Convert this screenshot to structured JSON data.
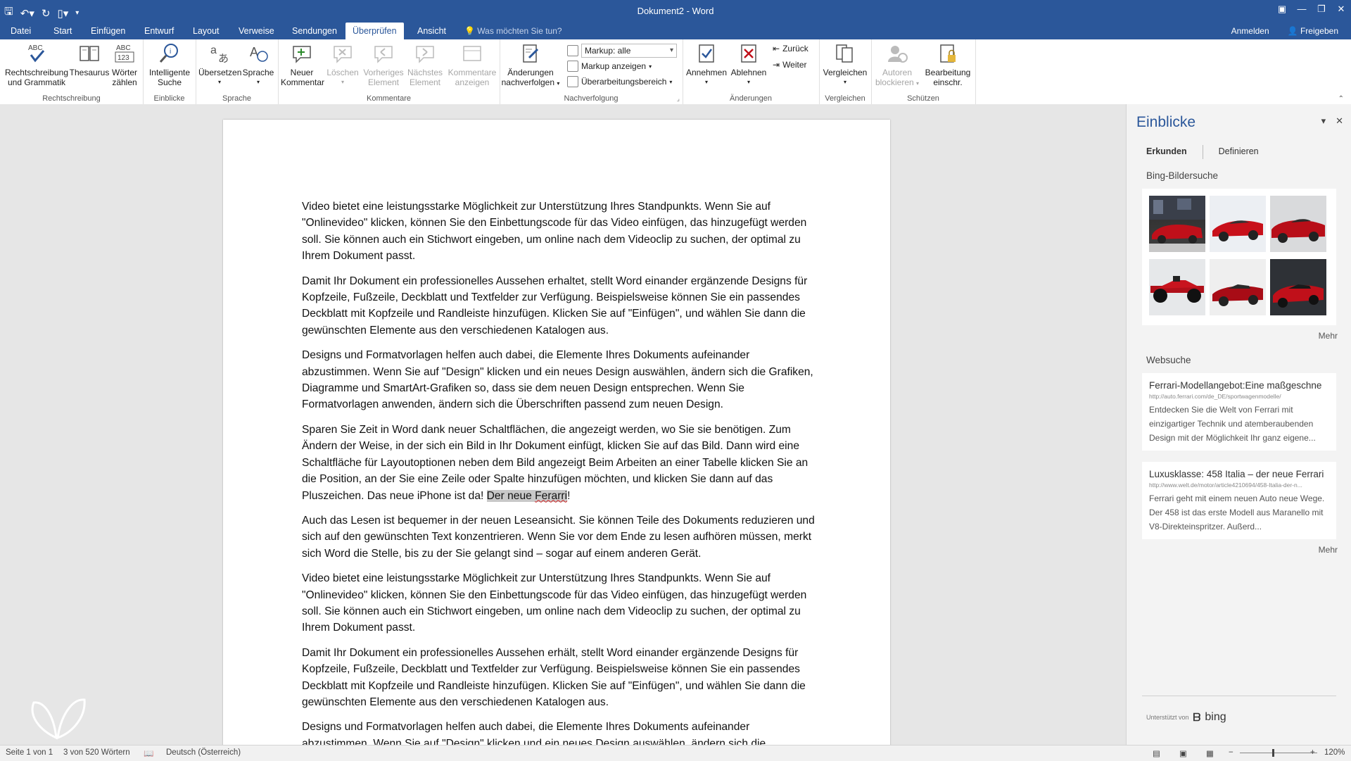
{
  "window": {
    "title": "Dokument2 - Word"
  },
  "tabs": [
    {
      "label": "Datei"
    },
    {
      "label": "Start"
    },
    {
      "label": "Einfügen"
    },
    {
      "label": "Entwurf"
    },
    {
      "label": "Layout"
    },
    {
      "label": "Verweise"
    },
    {
      "label": "Sendungen"
    },
    {
      "label": "Überprüfen"
    },
    {
      "label": "Ansicht"
    }
  ],
  "tell_me": "Was möchten Sie tun?",
  "account": {
    "signin": "Anmelden",
    "share": "Freigeben"
  },
  "ribbon": {
    "groups": {
      "rechtschreibung": "Rechtschreibung",
      "einblicke": "Einblicke",
      "sprache": "Sprache",
      "kommentare": "Kommentare",
      "nachverfolgung": "Nachverfolgung",
      "aenderungen": "Änderungen",
      "vergleichen": "Vergleichen",
      "schuetzen": "Schützen"
    },
    "buttons": {
      "spelling_1": "Rechtschreibung",
      "spelling_2": "und Grammatik",
      "thesaurus": "Thesaurus",
      "wordcount_1": "Wörter",
      "wordcount_2": "zählen",
      "smart_1": "Intelligente",
      "smart_2": "Suche",
      "translate": "Übersetzen",
      "language": "Sprache",
      "newcomment_1": "Neuer",
      "newcomment_2": "Kommentar",
      "delete": "Löschen",
      "prev_1": "Vorheriges",
      "prev_2": "Element",
      "next_1": "Nächstes",
      "next_2": "Element",
      "showcomments_1": "Kommentare",
      "showcomments_2": "anzeigen",
      "track_1": "Änderungen",
      "track_2": "nachverfolgen",
      "markup_combo": "Markup: alle",
      "show_markup": "Markup anzeigen",
      "review_pane": "Überarbeitungsbereich",
      "accept": "Annehmen",
      "reject": "Ablehnen",
      "back": "Zurück",
      "forward": "Weiter",
      "compare": "Vergleichen",
      "block_1": "Autoren",
      "block_2": "blockieren",
      "restrict_1": "Bearbeitung",
      "restrict_2": "einschr."
    }
  },
  "document": {
    "paragraphs": [
      "Video bietet eine leistungsstarke Möglichkeit zur Unterstützung Ihres Standpunkts. Wenn Sie auf \"Onlinevideo\" klicken, können Sie den Einbettungscode für das Video einfügen, das hinzugefügt werden soll. Sie können auch ein Stichwort eingeben, um online nach dem Videoclip zu suchen, der optimal zu Ihrem Dokument passt.",
      "Damit Ihr Dokument ein professionelles Aussehen erhaltet, stellt Word einander ergänzende Designs für Kopfzeile, Fußzeile, Deckblatt und Textfelder zur Verfügung. Beispielsweise können Sie ein passendes Deckblatt mit Kopfzeile und Randleiste hinzufügen. Klicken Sie auf \"Einfügen\", und wählen Sie dann die gewünschten Elemente aus den verschiedenen Katalogen aus.",
      "Designs und Formatvorlagen helfen auch dabei, die Elemente Ihres Dokuments aufeinander abzustimmen. Wenn Sie auf \"Design\" klicken und ein neues Design auswählen, ändern sich die Grafiken, Diagramme und SmartArt-Grafiken so, dass sie dem neuen Design entsprechen. Wenn Sie Formatvorlagen anwenden, ändern sich die Überschriften passend zum neuen Design.",
      "Sparen Sie Zeit in Word dank neuer Schaltflächen, die angezeigt werden, wo Sie sie benötigen. Zum Ändern der Weise, in der sich ein Bild in Ihr Dokument einfügt, klicken Sie auf das Bild. Dann wird eine Schaltfläche für Layoutoptionen neben dem Bild angezeigt Beim Arbeiten an einer Tabelle klicken Sie an die Position, an der Sie eine Zeile oder Spalte hinzufügen möchten, und klicken Sie dann auf das Pluszeichen. Das neue iPhone ist da!",
      "Auch das Lesen ist bequemer in der neuen Leseansicht. Sie können Teile des Dokuments reduzieren und sich auf den gewünschten Text konzentrieren. Wenn Sie vor dem Ende zu lesen aufhören müssen, merkt sich Word die Stelle, bis zu der Sie gelangt sind – sogar auf einem anderen Gerät.",
      "Video bietet eine leistungsstarke Möglichkeit zur Unterstützung Ihres Standpunkts. Wenn Sie auf \"Onlinevideo\" klicken, können Sie den Einbettungscode für das Video einfügen, das hinzugefügt werden soll. Sie können auch ein Stichwort eingeben, um online nach dem Videoclip zu suchen, der optimal zu Ihrem Dokument passt.",
      "Damit Ihr Dokument ein professionelles Aussehen erhält, stellt Word einander ergänzende Designs für Kopfzeile, Fußzeile, Deckblatt und Textfelder zur Verfügung. Beispielsweise können Sie ein passendes Deckblatt mit Kopfzeile und Randleiste hinzufügen. Klicken Sie auf \"Einfügen\", und wählen Sie dann die gewünschten Elemente aus den verschiedenen Katalogen aus.",
      "Designs und Formatvorlagen helfen auch dabei, die Elemente Ihres Dokuments aufeinander abzustimmen. Wenn Sie auf \"Design\" klicken und ein neues Design auswählen, ändern sich die"
    ],
    "selection_pre": "Der neue ",
    "selection_word": "Ferarri",
    "selection_post": "!"
  },
  "insights": {
    "title": "Einblicke",
    "tabs": {
      "explore": "Erkunden",
      "define": "Definieren"
    },
    "image_section": "Bing-Bildersuche",
    "more": "Mehr",
    "web_section": "Websuche",
    "results": [
      {
        "title": "Ferrari-Modellangebot:Eine maßgeschne",
        "url": "http://auto.ferrari.com/de_DE/sportwagenmodelle/",
        "desc": "Entdecken Sie die Welt von Ferrari mit einzigartiger Technik und atemberaubenden Design mit der Möglichkeit Ihr ganz eigene..."
      },
      {
        "title": "Luxusklasse: 458 Italia – der neue Ferrari",
        "url": "http://www.welt.de/motor/article4210694/458-Italia-der-n...",
        "desc": "Ferrari geht mit einem neuen Auto neue Wege. Der 458 ist das erste Modell aus Maranello mit V8-Direkteinspritzer. Außerd..."
      }
    ],
    "powered_by": "Unterstützt von",
    "bing": "bing"
  },
  "status": {
    "page": "Seite 1 von 1",
    "words": "3 von 520 Wörtern",
    "language": "Deutsch (Österreich)",
    "zoom": "120%"
  },
  "colors": {
    "accent": "#2b579a",
    "ferrari_red": "#c0101a"
  }
}
